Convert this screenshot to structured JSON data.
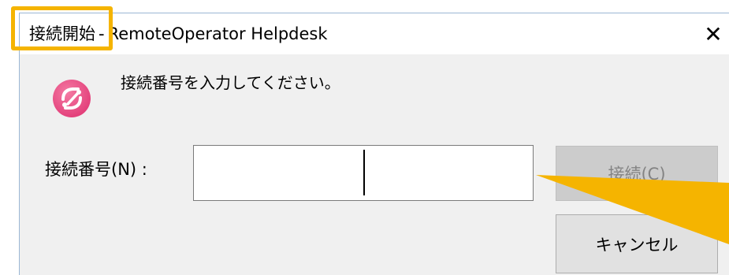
{
  "window": {
    "title_highlight": "接続開始",
    "title_separator": "-",
    "title_app": "RemoteOperator Helpdesk",
    "close_glyph": "✕"
  },
  "dialog": {
    "prompt": "接続番号を入力してください。",
    "field_label": "接続番号(N) :",
    "input_value": "",
    "connect_label": "接続(C)",
    "cancel_label": "キャンセル",
    "connect_enabled": false
  },
  "annotations": {
    "highlight_color": "#f5b400"
  },
  "icons": {
    "app": "remoteoperator-logo-icon",
    "close": "close-icon"
  }
}
